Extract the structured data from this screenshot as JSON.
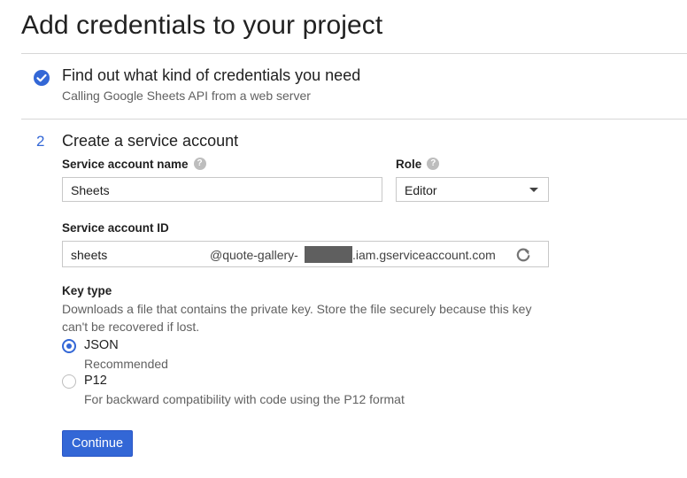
{
  "page": {
    "title": "Add credentials to your project"
  },
  "step1": {
    "title": "Find out what kind of credentials you need",
    "subtitle": "Calling Google Sheets API from a web server",
    "status_icon": "check-circle-icon"
  },
  "step2": {
    "number": "2",
    "title": "Create a service account",
    "service_account_name": {
      "label": "Service account name",
      "value": "Sheets"
    },
    "role": {
      "label": "Role",
      "selected": "Editor"
    },
    "service_account_id": {
      "label": "Service account ID",
      "value": "sheets",
      "domain_prefix": "@quote-gallery-",
      "domain_suffix": ".iam.gserviceaccount.com"
    },
    "key_type": {
      "label": "Key type",
      "description": "Downloads a file that contains the private key. Store the file securely because this key can't be recovered if lost.",
      "options": [
        {
          "label": "JSON",
          "description": "Recommended",
          "selected": true
        },
        {
          "label": "P12",
          "description": "For backward compatibility with code using the P12 format",
          "selected": false
        }
      ]
    },
    "continue_label": "Continue"
  },
  "colors": {
    "accent": "#3367d6",
    "redaction": "#5f5f5f"
  }
}
